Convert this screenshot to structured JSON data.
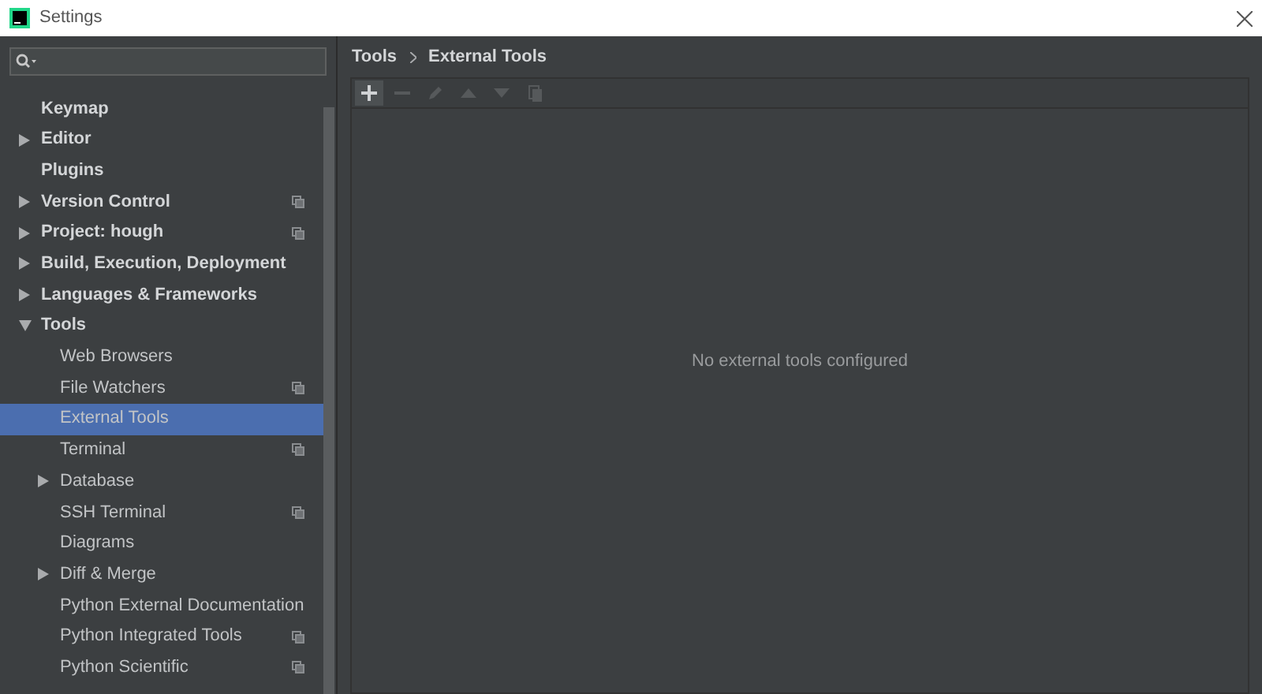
{
  "window": {
    "title": "Settings"
  },
  "sidebar": {
    "items": [
      {
        "label": "Keymap",
        "expandable": false,
        "project_scope": false,
        "selected": false
      },
      {
        "label": "Editor",
        "expandable": true,
        "expanded": false,
        "project_scope": false,
        "selected": false
      },
      {
        "label": "Plugins",
        "expandable": false,
        "project_scope": false,
        "selected": false
      },
      {
        "label": "Version Control",
        "expandable": true,
        "expanded": false,
        "project_scope": true,
        "selected": false
      },
      {
        "label": "Project: hough",
        "expandable": true,
        "expanded": false,
        "project_scope": true,
        "selected": false
      },
      {
        "label": "Build, Execution, Deployment",
        "expandable": true,
        "expanded": false,
        "project_scope": false,
        "selected": false
      },
      {
        "label": "Languages & Frameworks",
        "expandable": true,
        "expanded": false,
        "project_scope": false,
        "selected": false
      },
      {
        "label": "Tools",
        "expandable": true,
        "expanded": true,
        "project_scope": false,
        "selected": false,
        "children": [
          {
            "label": "Web Browsers",
            "expandable": false,
            "project_scope": false,
            "selected": false
          },
          {
            "label": "File Watchers",
            "expandable": false,
            "project_scope": true,
            "selected": false
          },
          {
            "label": "External Tools",
            "expandable": false,
            "project_scope": false,
            "selected": true
          },
          {
            "label": "Terminal",
            "expandable": false,
            "project_scope": true,
            "selected": false
          },
          {
            "label": "Database",
            "expandable": true,
            "expanded": false,
            "project_scope": false,
            "selected": false
          },
          {
            "label": "SSH Terminal",
            "expandable": false,
            "project_scope": true,
            "selected": false
          },
          {
            "label": "Diagrams",
            "expandable": false,
            "project_scope": false,
            "selected": false
          },
          {
            "label": "Diff & Merge",
            "expandable": true,
            "expanded": false,
            "project_scope": false,
            "selected": false
          },
          {
            "label": "Python External Documentation",
            "expandable": false,
            "project_scope": false,
            "selected": false
          },
          {
            "label": "Python Integrated Tools",
            "expandable": false,
            "project_scope": true,
            "selected": false
          },
          {
            "label": "Python Scientific",
            "expandable": false,
            "project_scope": true,
            "selected": false
          }
        ]
      }
    ]
  },
  "breadcrumb": [
    "Tools",
    "External Tools"
  ],
  "toolbar": [
    {
      "kind": "add",
      "disabled": false
    },
    {
      "kind": "remove",
      "disabled": true
    },
    {
      "kind": "edit",
      "disabled": true
    },
    {
      "kind": "up",
      "disabled": true
    },
    {
      "kind": "down",
      "disabled": true
    },
    {
      "kind": "copy",
      "disabled": true
    }
  ],
  "empty_message": "No external tools configured"
}
